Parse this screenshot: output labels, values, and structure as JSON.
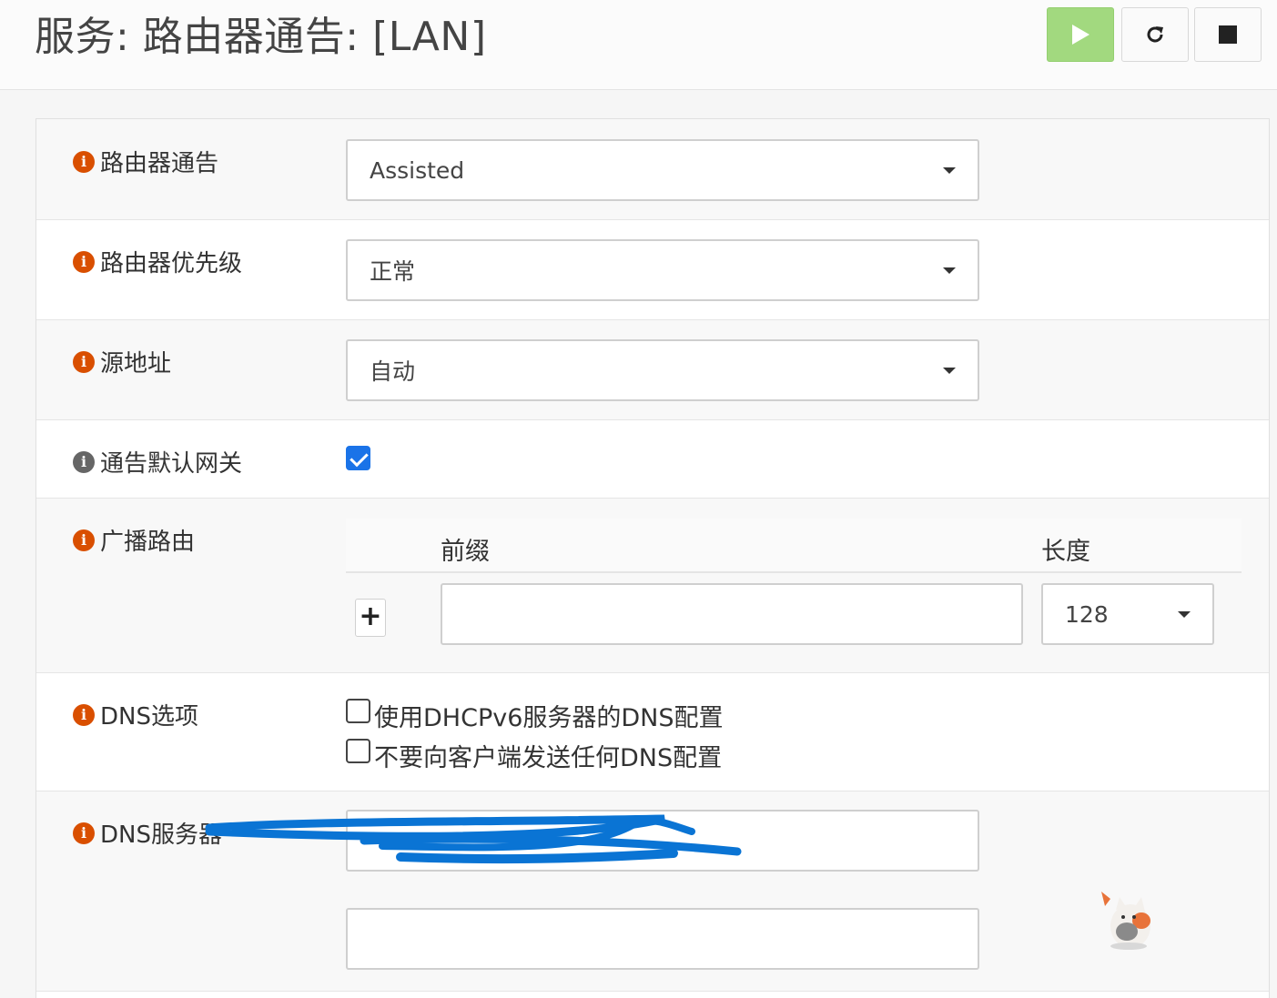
{
  "header": {
    "title": "服务: 路由器通告: [LAN]",
    "buttons": {
      "start": "play-icon",
      "restart": "refresh-icon",
      "stop": "stop-icon"
    }
  },
  "form": {
    "router_advertisements": {
      "label": "路由器通告",
      "value": "Assisted"
    },
    "router_priority": {
      "label": "路由器优先级",
      "value": "正常"
    },
    "source_address": {
      "label": "源地址",
      "value": "自动"
    },
    "advertise_default_gateway": {
      "label": "通告默认网关",
      "checked": true
    },
    "advertise_routes": {
      "label": "广播路由",
      "col_prefix": "前缀",
      "col_length": "长度",
      "add_label": "+",
      "rows": [
        {
          "prefix": "",
          "length": "128"
        }
      ]
    },
    "dns_options": {
      "label": "DNS选项",
      "options": [
        {
          "label": "使用DHCPv6服务器的DNS配置",
          "checked": false
        },
        {
          "label": "不要向客户端发送任何DNS配置",
          "checked": false
        }
      ]
    },
    "dns_servers": {
      "label": "DNS服务器",
      "values": [
        "",
        ""
      ]
    }
  },
  "colors": {
    "info_icon": "#d94f00",
    "start_button": "#a2d97f",
    "checkbox_checked": "#1a73e8",
    "redaction": "#0a74d4"
  }
}
